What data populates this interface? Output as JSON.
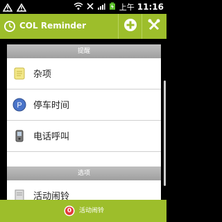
{
  "status": {
    "time": "11:16",
    "am_pm": "上午"
  },
  "header": {
    "title": "COL Reminder"
  },
  "sections": {
    "reminders": {
      "header": "提醒",
      "items": [
        {
          "label": "杂项"
        },
        {
          "label": "停车时间"
        },
        {
          "label": "电话呼叫"
        }
      ]
    },
    "options": {
      "header": "选项",
      "items": [
        {
          "label": "活动闹铃"
        }
      ]
    }
  },
  "bottom": {
    "badge": "0",
    "label": "活动闹铃"
  },
  "colors": {
    "accent": "#9dbe2b",
    "badge": "#e23b3b"
  }
}
